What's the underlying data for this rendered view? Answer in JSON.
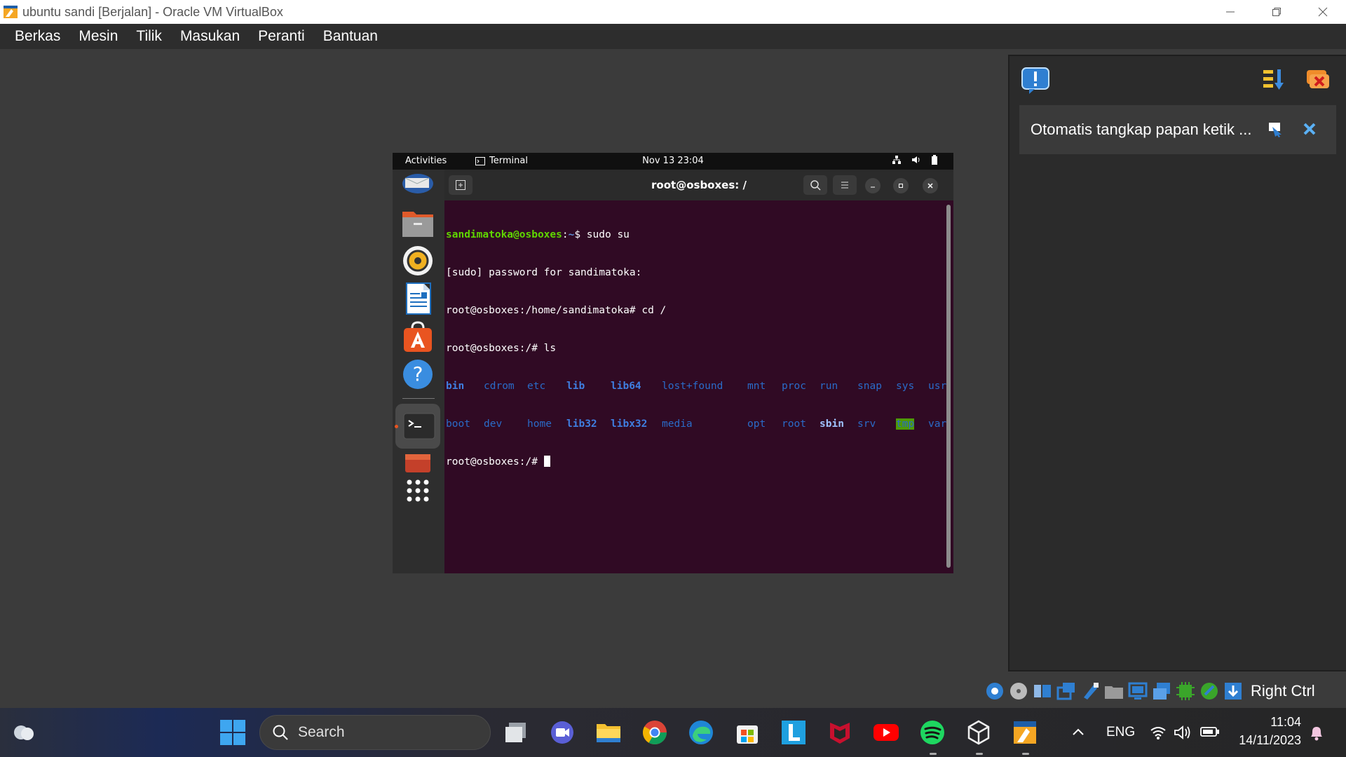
{
  "window": {
    "title": "ubuntu sandi [Berjalan] - Oracle VM VirtualBox"
  },
  "menubar": {
    "items": [
      "Berkas",
      "Mesin",
      "Tilik",
      "Masukan",
      "Peranti",
      "Bantuan"
    ]
  },
  "notification": {
    "message": "Otomatis tangkap papan ketik ..."
  },
  "gnome": {
    "activities": "Activities",
    "app": "Terminal",
    "clock": "Nov 13  23:04"
  },
  "terminal": {
    "title": "root@osboxes: /",
    "line1_user": "sandimatoka@osboxes",
    "line1_path": "~",
    "line1_cmd": "$ sudo su",
    "line2": "[sudo] password for sandimatoka:",
    "line3": "root@osboxes:/home/sandimatoka# cd /",
    "line4": "root@osboxes:/# ls",
    "ls_row1": [
      "bin",
      "cdrom",
      "etc",
      "lib",
      "lib64",
      "lost+found",
      "mnt",
      "proc",
      "run",
      "snap",
      "sys",
      "usr"
    ],
    "ls_row2": [
      "boot",
      "dev",
      "home",
      "lib32",
      "libx32",
      "media",
      "opt",
      "root",
      "sbin",
      "srv",
      "tmp",
      "var"
    ],
    "prompt": "root@osboxes:/# "
  },
  "statusbar": {
    "host_key": "Right Ctrl"
  },
  "taskbar": {
    "search_label": "Search",
    "language": "ENG",
    "time": "11:04",
    "date": "14/11/2023"
  },
  "colors": {
    "terminal_bg": "#300a24",
    "prompt_user": "#5fd700",
    "prompt_path": "#5c8fd6",
    "dir_color": "#2a6bc8",
    "tmp_highlight": "#4e9a06"
  }
}
